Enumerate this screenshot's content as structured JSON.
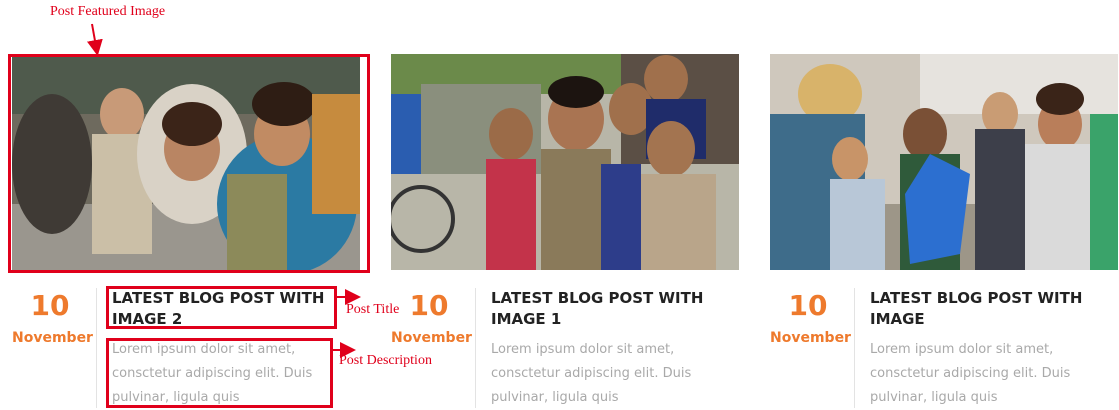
{
  "annotations": {
    "featured_image": "Post Featured Image",
    "post_title": "Post Title",
    "post_description": "Post Description"
  },
  "colors": {
    "annotation_red": "#e0001b",
    "date_orange": "#ee7a2d",
    "title": "#222222",
    "description": "#a9a9a9"
  },
  "posts": [
    {
      "day": "10",
      "month": "November",
      "title": "LATEST BLOG POST WITH IMAGE 2",
      "description": "Lorem ipsum dolor sit amet, consctetur adipiscing elit. Duis pulvinar, ligula quis"
    },
    {
      "day": "10",
      "month": "November",
      "title": "LATEST BLOG POST WITH IMAGE 1",
      "description": "Lorem ipsum dolor sit amet, consctetur adipiscing elit. Duis pulvinar, ligula quis"
    },
    {
      "day": "10",
      "month": "November",
      "title": "LATEST BLOG POST WITH IMAGE",
      "description": "Lorem ipsum dolor sit amet, consctetur adipiscing elit. Duis pulvinar, ligula quis"
    }
  ]
}
